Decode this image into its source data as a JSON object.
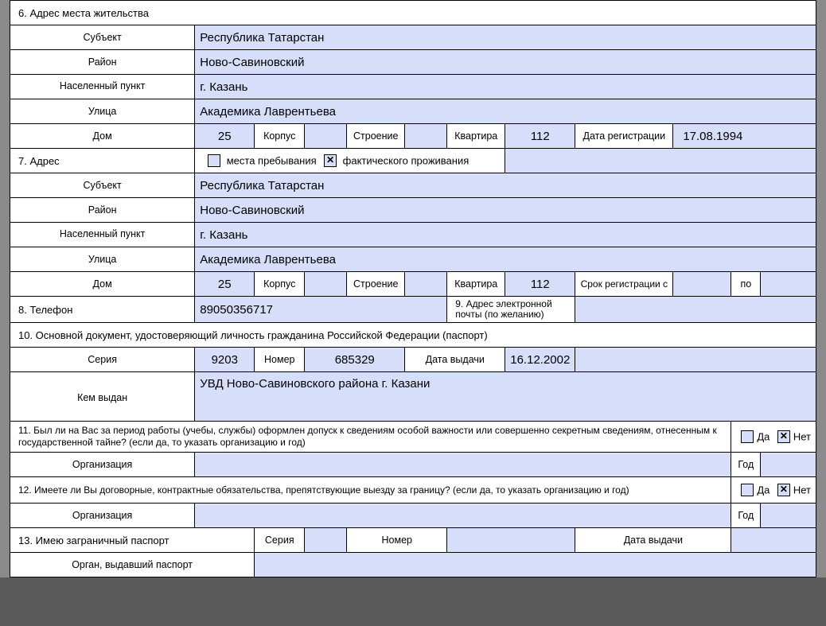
{
  "s6": {
    "title": "6. Адрес места жительства",
    "subject_lbl": "Субъект",
    "subject": "Республика Татарстан",
    "district_lbl": "Район",
    "district": "Ново-Савиновский",
    "locality_lbl": "Населенный пункт",
    "locality": "г. Казань",
    "street_lbl": "Улица",
    "street": "Академика Лаврентьева",
    "house_lbl": "Дом",
    "house": "25",
    "korpus_lbl": "Корпус",
    "korpus": "",
    "stroenie_lbl": "Строение",
    "stroenie": "",
    "kv_lbl": "Квартира",
    "kv": "112",
    "regdate_lbl": "Дата регистрации",
    "regdate": "17.08.1994"
  },
  "s7": {
    "title": "7. Адрес",
    "stay_lbl": "места пребывания",
    "actual_lbl": "фактического проживания",
    "stay_chk": "",
    "actual_chk": "✕",
    "subject_lbl": "Субъект",
    "subject": "Республика Татарстан",
    "district_lbl": "Район",
    "district": "Ново-Савиновский",
    "locality_lbl": "Населенный пункт",
    "locality": "г. Казань",
    "street_lbl": "Улица",
    "street": "Академика Лаврентьева",
    "house_lbl": "Дом",
    "house": "25",
    "korpus_lbl": "Корпус",
    "korpus": "",
    "stroenie_lbl": "Строение",
    "stroenie": "",
    "kv_lbl": "Квартира",
    "kv": "112",
    "regterm_lbl": "Срок регистрации с",
    "regfrom": "",
    "regto_lbl": "по",
    "regto": ""
  },
  "s8": {
    "title": "8. Телефон",
    "phone": "89050356717",
    "email_lbl": "9. Адрес электронной почты (по желанию)",
    "email": ""
  },
  "s10": {
    "title": "10. Основной документ, удостоверяющий личность гражданина Российской Федерации (паспорт)",
    "seria_lbl": "Серия",
    "seria": "9203",
    "nomer_lbl": "Номер",
    "nomer": "685329",
    "date_lbl": "Дата выдачи",
    "date": "16.12.2002",
    "issued_lbl": "Кем выдан",
    "issued": "УВД Ново-Савиновского района г. Казани"
  },
  "s11": {
    "title": "11. Был ли на Вас за период работы (учебы, службы) оформлен допуск к сведениям особой важности или совершенно секретным сведениям, отнесенным к государственной тайне? (если да, то указать организацию и год)",
    "da_lbl": "Да",
    "net_lbl": "Нет",
    "da_chk": "",
    "net_chk": "✕",
    "org_lbl": "Организация",
    "org": "",
    "year_lbl": "Год",
    "year": ""
  },
  "s12": {
    "title": "12. Имеете ли Вы договорные, контрактные обязательства, препятствующие выезду за границу? (если да, то указать организацию и год)",
    "da_lbl": "Да",
    "net_lbl": "Нет",
    "da_chk": "",
    "net_chk": "✕",
    "org_lbl": "Организация",
    "org": "",
    "year_lbl": "Год",
    "year": ""
  },
  "s13": {
    "title": "13. Имею заграничный паспорт",
    "seria_lbl": "Серия",
    "seria": "",
    "nomer_lbl": "Номер",
    "nomer": "",
    "date_lbl": "Дата выдачи",
    "date": "",
    "issued_lbl": "Орган, выдавший паспорт",
    "issued": ""
  }
}
